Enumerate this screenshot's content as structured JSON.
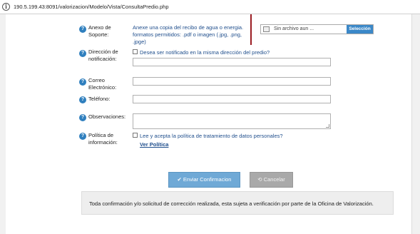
{
  "browser": {
    "url": "190.5.199.43:8091/valorizacion/Modelo/Vista/ConsultaPredio.php"
  },
  "help_glyph": "?",
  "form": {
    "anexo": {
      "label": "Anexo de Soporte:",
      "instructions": "Anexe una copia del recibo de agua o energia. formatos permitidos: .pdf o imagen (.jpg, .png, .jpge)",
      "file_placeholder": "Sin archivo aun ...",
      "select_button": "Selección"
    },
    "direccion": {
      "label": "Dirección de notificación:",
      "checkbox_label": "Desea ser notificado en la misma dirección del predio?",
      "value": ""
    },
    "correo": {
      "label": "Correo Electrónico:",
      "value": ""
    },
    "telefono": {
      "label": "Teléfono:",
      "value": ""
    },
    "observaciones": {
      "label": "Observaciones:",
      "value": ""
    },
    "politica": {
      "label": "Política de información:",
      "checkbox_label": "Lee y acepta la política de tratamiento de datos personales?",
      "link": "Ver Política"
    }
  },
  "buttons": {
    "submit": "Enviar Confirmacion",
    "cancel": "Cancelar",
    "submit_icon": "✔",
    "cancel_icon": "⟲"
  },
  "notice": "Toda confirmación y/o solicitud de corrección realizada, esta sujeta a verificación por parte de la Oficina de Valorización."
}
